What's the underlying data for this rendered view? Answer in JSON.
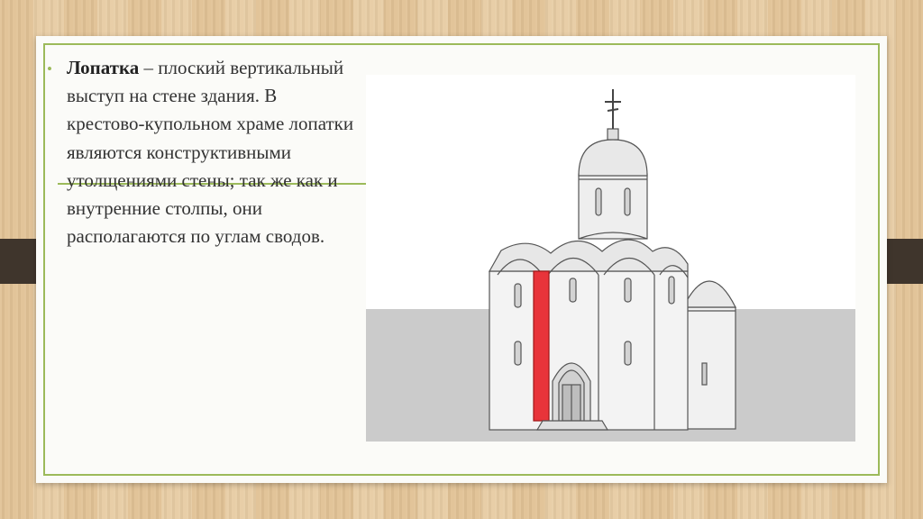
{
  "slide": {
    "term": "Лопатка",
    "definition": " – плоский вертикальный выступ на стене здания. В крестово-купольном храме лопатки являются конструктивными утолщениями стены; так же как и внутренние столпы, они располагаются по углам сводов."
  },
  "colors": {
    "frame_accent": "#9cba5a",
    "highlight_pilaster": "#e8343a",
    "ground": "#cccccc",
    "side_tabs": "#3f352c"
  },
  "icons": {
    "bullet": "bullet-icon"
  }
}
